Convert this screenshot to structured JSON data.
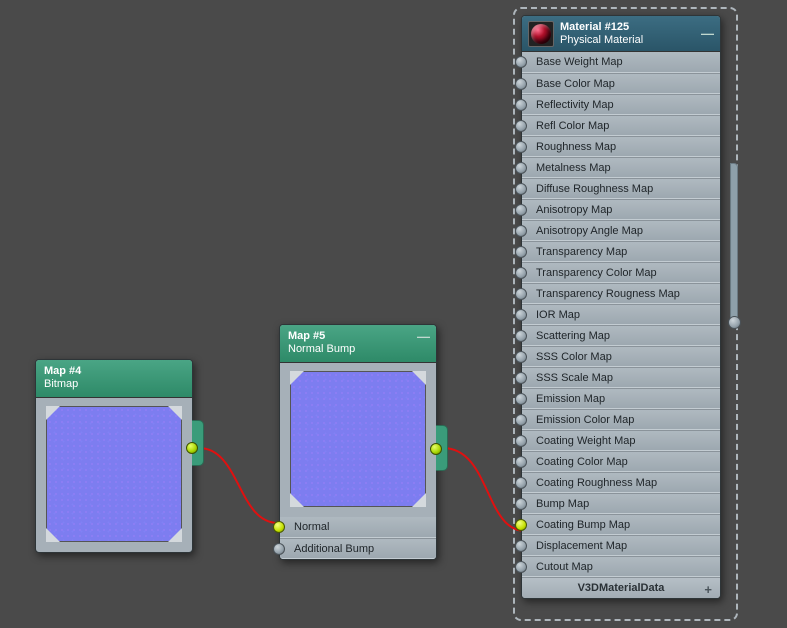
{
  "node_bitmap": {
    "title": "Map #4",
    "subtitle": "Bitmap"
  },
  "node_normal": {
    "title": "Map #5",
    "subtitle": "Normal Bump",
    "inputs": [
      "Normal",
      "Additional Bump"
    ]
  },
  "node_material": {
    "title": "Material #125",
    "subtitle": "Physical Material",
    "slots": [
      "Base Weight Map",
      "Base Color Map",
      "Reflectivity Map",
      "Refl Color Map",
      "Roughness Map",
      "Metalness Map",
      "Diffuse Roughness Map",
      "Anisotropy Map",
      "Anisotropy Angle Map",
      "Transparency Map",
      "Transparency Color Map",
      "Transparency Rougness Map",
      "IOR Map",
      "Scattering Map",
      "SSS Color Map",
      "SSS Scale Map",
      "Emission Map",
      "Emission Color Map",
      "Coating Weight Map",
      "Coating Color Map",
      "Coating Roughness Map",
      "Bump Map",
      "Coating Bump Map",
      "Displacement Map",
      "Cutout Map"
    ],
    "active_slot_index": 22,
    "footer": "V3DMaterialData"
  },
  "collapse_glyph": "—",
  "plus_glyph": "+"
}
